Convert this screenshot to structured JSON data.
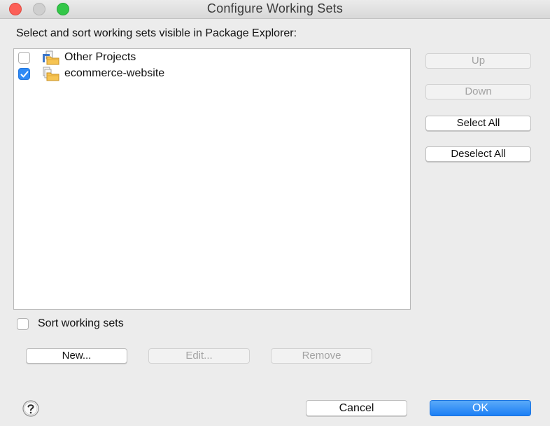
{
  "window": {
    "title": "Configure Working Sets"
  },
  "main": {
    "instruction": "Select and sort working sets visible in Package Explorer:",
    "working_sets": [
      {
        "label": "Other Projects",
        "checked": false,
        "icon": "other-projects-folder-icon"
      },
      {
        "label": "ecommerce-website",
        "checked": true,
        "icon": "working-set-folder-icon"
      }
    ]
  },
  "side_buttons": {
    "up": "Up",
    "down": "Down",
    "select_all": "Select All",
    "deselect_all": "Deselect All"
  },
  "sort": {
    "label": "Sort working sets",
    "checked": false
  },
  "actions": {
    "new": "New...",
    "edit": "Edit...",
    "remove": "Remove"
  },
  "footer": {
    "cancel": "Cancel",
    "ok": "OK",
    "help_icon": "help-icon"
  },
  "colors": {
    "accent": "#1b7ff5",
    "close": "#fc5f57",
    "zoom": "#33c748"
  }
}
